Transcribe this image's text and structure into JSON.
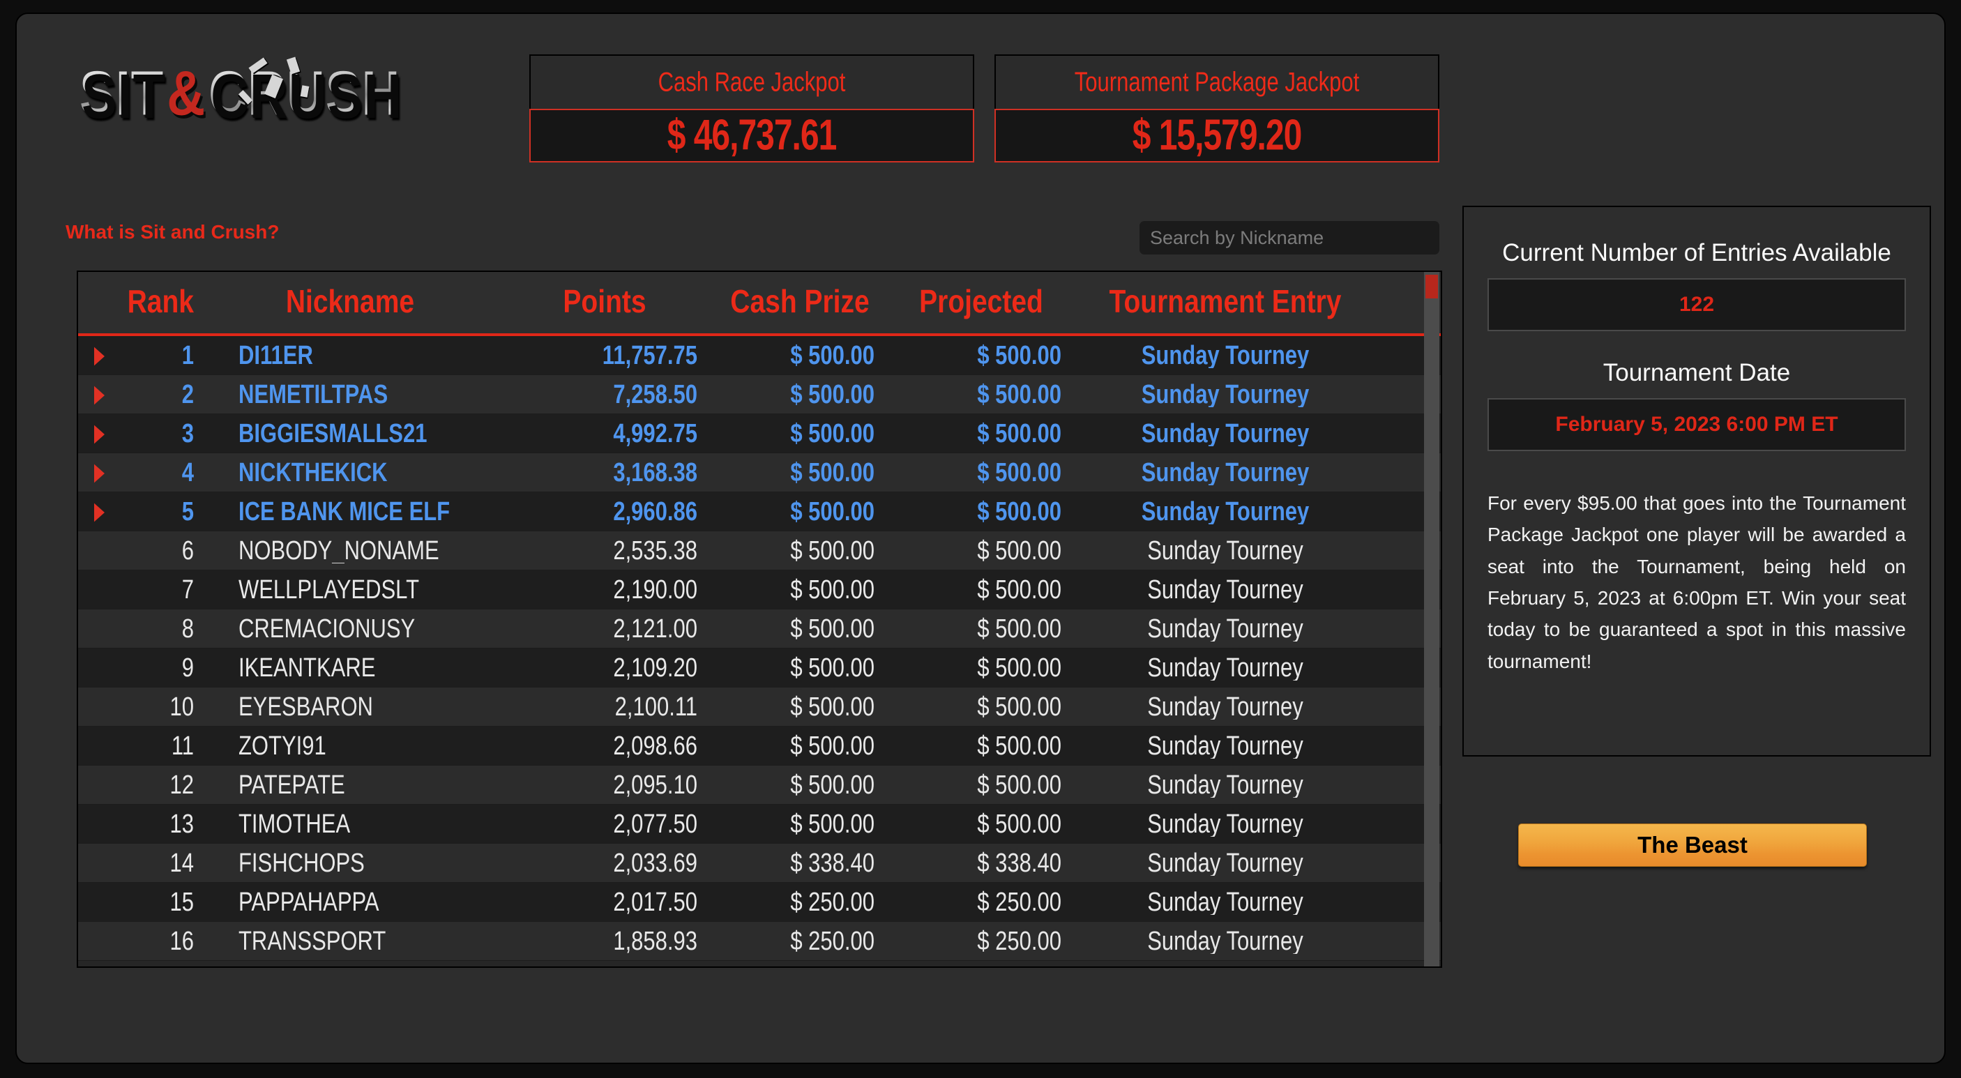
{
  "brand": {
    "logo_part1": "SIT",
    "logo_amp": "&",
    "logo_part2": "CRUSH"
  },
  "jackpots": [
    {
      "label": "Cash Race Jackpot",
      "value": "$ 46,737.61"
    },
    {
      "label": "Tournament Package Jackpot",
      "value": "$ 15,579.20"
    }
  ],
  "toolbar": {
    "what_is_link": "What is Sit and Crush?",
    "search_placeholder": "Search by Nickname",
    "search_value": ""
  },
  "leaderboard": {
    "columns": [
      "Rank",
      "Nickname",
      "Points",
      "Cash Prize",
      "Projected",
      "Tournament Entry"
    ],
    "rows": [
      {
        "rank": "1",
        "nickname": "DI11ER",
        "points": "11,757.75",
        "cash_prize": "$ 500.00",
        "projected": "$ 500.00",
        "entry": "Sunday Tourney",
        "highlight": true
      },
      {
        "rank": "2",
        "nickname": "NEMETILTPAS",
        "points": "7,258.50",
        "cash_prize": "$ 500.00",
        "projected": "$ 500.00",
        "entry": "Sunday Tourney",
        "highlight": true
      },
      {
        "rank": "3",
        "nickname": "BIGGIESMALLS21",
        "points": "4,992.75",
        "cash_prize": "$ 500.00",
        "projected": "$ 500.00",
        "entry": "Sunday Tourney",
        "highlight": true
      },
      {
        "rank": "4",
        "nickname": "NICKTHEKICK",
        "points": "3,168.38",
        "cash_prize": "$ 500.00",
        "projected": "$ 500.00",
        "entry": "Sunday Tourney",
        "highlight": true
      },
      {
        "rank": "5",
        "nickname": "ICE BANK MICE ELF",
        "points": "2,960.86",
        "cash_prize": "$ 500.00",
        "projected": "$ 500.00",
        "entry": "Sunday Tourney",
        "highlight": true
      },
      {
        "rank": "6",
        "nickname": "NOBODY_NONAME",
        "points": "2,535.38",
        "cash_prize": "$ 500.00",
        "projected": "$ 500.00",
        "entry": "Sunday Tourney",
        "highlight": false
      },
      {
        "rank": "7",
        "nickname": "WELLPLAYEDSLT",
        "points": "2,190.00",
        "cash_prize": "$ 500.00",
        "projected": "$ 500.00",
        "entry": "Sunday Tourney",
        "highlight": false
      },
      {
        "rank": "8",
        "nickname": "CREMACIONUSY",
        "points": "2,121.00",
        "cash_prize": "$ 500.00",
        "projected": "$ 500.00",
        "entry": "Sunday Tourney",
        "highlight": false
      },
      {
        "rank": "9",
        "nickname": "IKEANTKARE",
        "points": "2,109.20",
        "cash_prize": "$ 500.00",
        "projected": "$ 500.00",
        "entry": "Sunday Tourney",
        "highlight": false
      },
      {
        "rank": "10",
        "nickname": "EYESBARON",
        "points": "2,100.11",
        "cash_prize": "$ 500.00",
        "projected": "$ 500.00",
        "entry": "Sunday Tourney",
        "highlight": false
      },
      {
        "rank": "11",
        "nickname": "ZOTYI91",
        "points": "2,098.66",
        "cash_prize": "$ 500.00",
        "projected": "$ 500.00",
        "entry": "Sunday Tourney",
        "highlight": false
      },
      {
        "rank": "12",
        "nickname": "PATEPATE",
        "points": "2,095.10",
        "cash_prize": "$ 500.00",
        "projected": "$ 500.00",
        "entry": "Sunday Tourney",
        "highlight": false
      },
      {
        "rank": "13",
        "nickname": "TIMOTHEA",
        "points": "2,077.50",
        "cash_prize": "$ 500.00",
        "projected": "$ 500.00",
        "entry": "Sunday Tourney",
        "highlight": false
      },
      {
        "rank": "14",
        "nickname": "FISHCHOPS",
        "points": "2,033.69",
        "cash_prize": "$ 338.40",
        "projected": "$ 338.40",
        "entry": "Sunday Tourney",
        "highlight": false
      },
      {
        "rank": "15",
        "nickname": "PAPPAHAPPA",
        "points": "2,017.50",
        "cash_prize": "$ 250.00",
        "projected": "$ 250.00",
        "entry": "Sunday Tourney",
        "highlight": false
      },
      {
        "rank": "16",
        "nickname": "TRANSSPORT",
        "points": "1,858.93",
        "cash_prize": "$ 250.00",
        "projected": "$ 250.00",
        "entry": "Sunday Tourney",
        "highlight": false
      }
    ]
  },
  "info_panel": {
    "entries_title": "Current Number of Entries Available",
    "entries_value": "122",
    "date_title": "Tournament Date",
    "date_value": "February 5, 2023 6:00 PM ET",
    "description": "For every $95.00 that goes into the Tournament Package Jackpot one player will be awarded a seat into the Tournament, being held on February 5, 2023 at 6:00pm ET. Win your seat today to be guaranteed a spot in this massive tournament!"
  },
  "beast_button": {
    "label": "The Beast"
  },
  "colors": {
    "accent_red": "#e02718",
    "highlight_blue": "#4f95ee",
    "button_orange": "#f0a63d",
    "panel_bg": "#2d2d2d",
    "page_bg": "#0d0d0d"
  }
}
